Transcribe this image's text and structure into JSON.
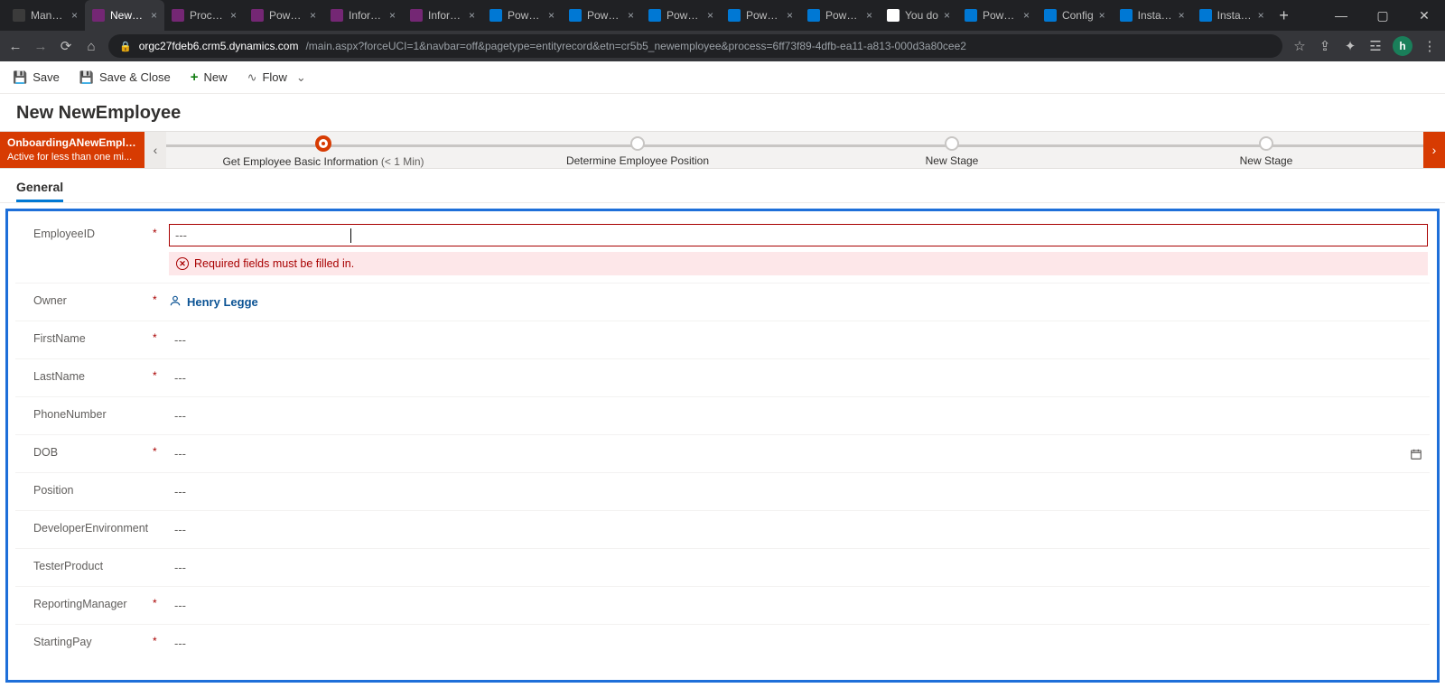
{
  "browser": {
    "tabs": [
      {
        "title": "Manage",
        "favicon": "#3b3b3b"
      },
      {
        "title": "NewEm",
        "favicon": "#742774",
        "active": true
      },
      {
        "title": "Process",
        "favicon": "#742774"
      },
      {
        "title": "Power A",
        "favicon": "#742774"
      },
      {
        "title": "Informa",
        "favicon": "#742774"
      },
      {
        "title": "Informa",
        "favicon": "#742774"
      },
      {
        "title": "Power P",
        "favicon": "#0078d4"
      },
      {
        "title": "Power P",
        "favicon": "#0078d4"
      },
      {
        "title": "Power P",
        "favicon": "#0078d4"
      },
      {
        "title": "Power P",
        "favicon": "#0078d4"
      },
      {
        "title": "Power P",
        "favicon": "#0078d4"
      },
      {
        "title": "You do",
        "favicon": "#ffffff"
      },
      {
        "title": "Power P",
        "favicon": "#0078d4"
      },
      {
        "title": "Config",
        "favicon": "#0078d4"
      },
      {
        "title": "Install a",
        "favicon": "#0078d4"
      },
      {
        "title": "Install a",
        "favicon": "#0078d4"
      }
    ],
    "address_host": "orgc27fdeb6.crm5.dynamics.com",
    "address_path": "/main.aspx?forceUCI=1&navbar=off&pagetype=entityrecord&etn=cr5b5_newemployee&process=6ff73f89-4dfb-ea11-a813-000d3a80cee2",
    "avatar_letter": "h"
  },
  "commandbar": {
    "save": "Save",
    "saveclose": "Save & Close",
    "new": "New",
    "flow": "Flow"
  },
  "page": {
    "title": "New NewEmployee"
  },
  "bpf": {
    "process_name": "OnboardingANewEmplo...",
    "status_line": "Active for less than one mi...",
    "stages": [
      {
        "label": "Get Employee Basic Information",
        "duration": "(< 1 Min)",
        "active": true
      },
      {
        "label": "Determine Employee Position",
        "duration": "",
        "active": false
      },
      {
        "label": "New Stage",
        "duration": "",
        "active": false
      },
      {
        "label": "New Stage",
        "duration": "",
        "active": false
      }
    ]
  },
  "formtab": {
    "general": "General"
  },
  "form": {
    "placeholder": "---",
    "employeeid": {
      "label": "EmployeeID",
      "required": "*",
      "value": "---",
      "error": "Required fields must be filled in."
    },
    "owner": {
      "label": "Owner",
      "required": "*",
      "value": "Henry Legge"
    },
    "firstname": {
      "label": "FirstName",
      "required": "*",
      "value": "---"
    },
    "lastname": {
      "label": "LastName",
      "required": "*",
      "value": "---"
    },
    "phonenumber": {
      "label": "PhoneNumber",
      "required": "",
      "value": "---"
    },
    "dob": {
      "label": "DOB",
      "required": "*",
      "value": "---"
    },
    "position": {
      "label": "Position",
      "required": "",
      "value": "---"
    },
    "devenv": {
      "label": "DeveloperEnvironment",
      "required": "",
      "value": "---"
    },
    "testerproduct": {
      "label": "TesterProduct",
      "required": "",
      "value": "---"
    },
    "reportingmanager": {
      "label": "ReportingManager",
      "required": "*",
      "value": "---"
    },
    "startingpay": {
      "label": "StartingPay",
      "required": "*",
      "value": "---"
    }
  }
}
